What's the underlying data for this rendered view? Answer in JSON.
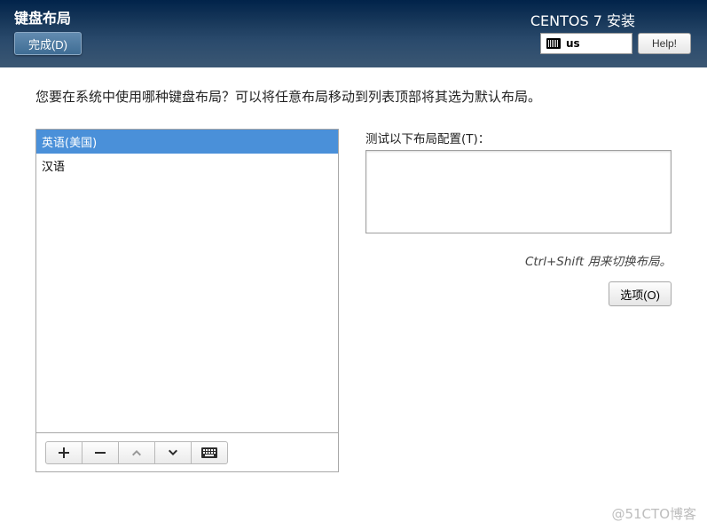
{
  "header": {
    "page_title": "键盘布局",
    "done_label": "完成(D)",
    "installer_title": "CENTOS 7 安装",
    "help_label": "Help!",
    "current_layout_code": "us"
  },
  "instruction": "您要在系统中使用哪种键盘布局？可以将任意布局移动到列表顶部将其选为默认布局。",
  "layouts": {
    "items": [
      {
        "label": "英语(美国)",
        "selected": true
      },
      {
        "label": "汉语",
        "selected": false
      }
    ]
  },
  "toolbar_icons": {
    "add": "plus-icon",
    "remove": "minus-icon",
    "move_up": "chevron-up-icon",
    "move_down": "chevron-down-icon",
    "preview": "keyboard-icon"
  },
  "test": {
    "label": "测试以下布局配置(T)：",
    "value": "",
    "hint": "Ctrl+Shift 用来切换布局。"
  },
  "options_label": "选项(O)",
  "watermark": "@51CTO博客"
}
